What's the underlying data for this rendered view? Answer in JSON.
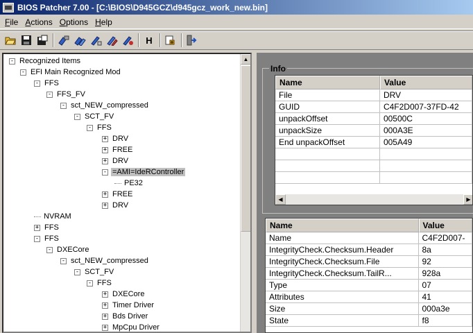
{
  "window": {
    "title": "BIOS Patcher 7.00 - [C:\\BIOS\\D945GCZ\\d945gcz_work_new.bin]"
  },
  "menu": [
    {
      "label": "File",
      "u": "F",
      "rest": "ile"
    },
    {
      "label": "Actions",
      "u": "A",
      "rest": "ctions"
    },
    {
      "label": "Options",
      "u": "O",
      "rest": "ptions"
    },
    {
      "label": "Help",
      "u": "H",
      "rest": "elp"
    }
  ],
  "toolbar": {
    "icons": [
      "open-folder-icon",
      "save-disk-icon",
      "save-as-icon",
      "patch-icon",
      "patch-all-icon",
      "edit-icon",
      "edit-all-icon",
      "replace-icon",
      "hex-icon",
      "module-icon",
      "exit-icon"
    ],
    "hex_label": "H"
  },
  "tree": {
    "nodes": [
      {
        "label": "Recognized Items",
        "toggle": "-"
      },
      {
        "label": "EFI Main Recognized Mod",
        "toggle": "-"
      },
      {
        "label": "FFS",
        "toggle": "-"
      },
      {
        "label": "FFS_FV",
        "toggle": "-"
      },
      {
        "label": "sct_NEW_compressed",
        "toggle": "-"
      },
      {
        "label": "SCT_FV",
        "toggle": "-"
      },
      {
        "label": "FFS",
        "toggle": "-"
      },
      {
        "label": "DRV",
        "toggle": "+"
      },
      {
        "label": "FREE",
        "toggle": "+"
      },
      {
        "label": "DRV",
        "toggle": "+"
      },
      {
        "label": "=AMI=IdeRController",
        "toggle": "-"
      },
      {
        "label": "PE32",
        "toggle": ""
      },
      {
        "label": "FREE",
        "toggle": "+"
      },
      {
        "label": "DRV",
        "toggle": "+"
      },
      {
        "label": "NVRAM",
        "toggle": ""
      },
      {
        "label": "FFS",
        "toggle": "+"
      },
      {
        "label": "FFS",
        "toggle": "-"
      },
      {
        "label": "DXECore",
        "toggle": "-"
      },
      {
        "label": "sct_NEW_compressed",
        "toggle": "-"
      },
      {
        "label": "SCT_FV",
        "toggle": "-"
      },
      {
        "label": "FFS",
        "toggle": "-"
      },
      {
        "label": "DXECore",
        "toggle": "+"
      },
      {
        "label": "Timer Driver",
        "toggle": "+"
      },
      {
        "label": "Bds Driver",
        "toggle": "+"
      },
      {
        "label": "MpCpu Driver",
        "toggle": "+"
      }
    ]
  },
  "info": {
    "group_label": "Info",
    "headers": [
      "Name",
      "Value"
    ],
    "rows": [
      [
        "File",
        "DRV"
      ],
      [
        "GUID",
        "C4F2D007-37FD-42"
      ],
      [
        "unpackOffset",
        "00500C"
      ],
      [
        "unpackSize",
        "000A3E"
      ],
      [
        "End unpackOffset",
        "005A49"
      ]
    ]
  },
  "details": {
    "headers": [
      "Name",
      "Value"
    ],
    "rows": [
      [
        "Name",
        "C4F2D007-"
      ],
      [
        "IntegrityCheck.Checksum.Header",
        "8a"
      ],
      [
        "IntegrityCheck.Checksum.File",
        "92"
      ],
      [
        "IntegrityCheck.Checksum.TailR...",
        "928a"
      ],
      [
        "Type",
        "07"
      ],
      [
        "Attributes",
        "41"
      ],
      [
        "Size",
        "000a3e"
      ],
      [
        "State",
        "f8"
      ]
    ]
  }
}
